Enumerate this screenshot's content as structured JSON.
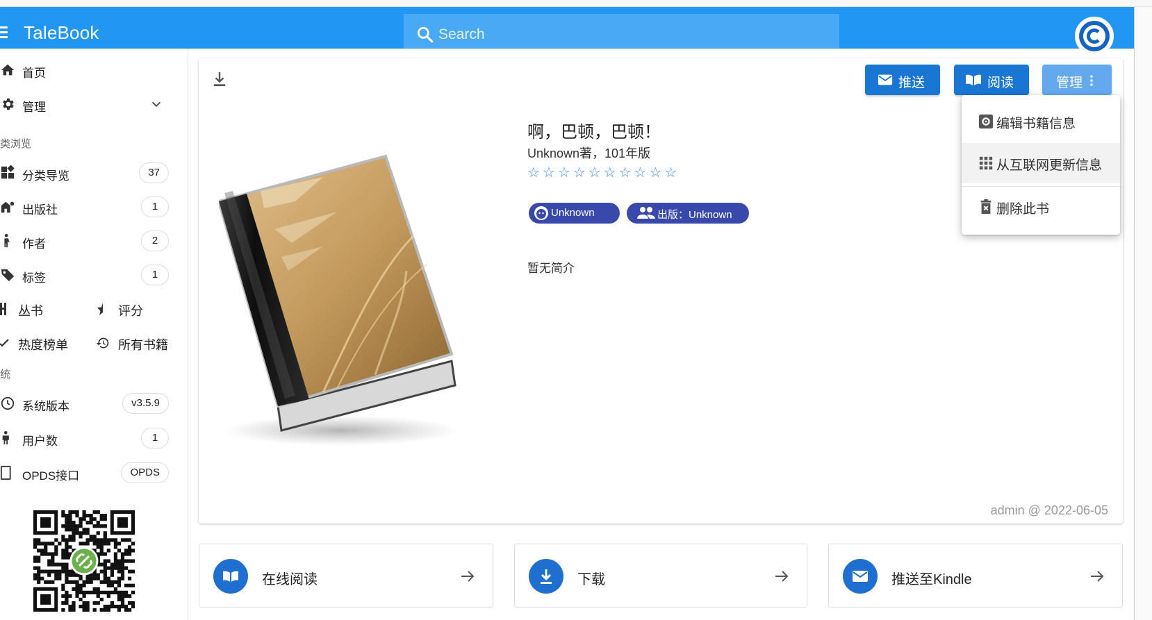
{
  "app": {
    "title": "TaleBook"
  },
  "search": {
    "placeholder": "Search"
  },
  "sidebar": {
    "home": "首页",
    "manage": "管理",
    "section_browse": "类浏览",
    "categories": [
      {
        "label": "分类导览",
        "count": "37"
      },
      {
        "label": "出版社",
        "count": "1"
      },
      {
        "label": "作者",
        "count": "2"
      },
      {
        "label": "标签",
        "count": "1"
      }
    ],
    "series": "丛书",
    "rating": "评分",
    "hot": "热度榜单",
    "all_books": "所有书籍",
    "section_system": "统",
    "system": [
      {
        "label": "系统版本",
        "count": "v3.5.9"
      },
      {
        "label": "用户数",
        "count": "1"
      },
      {
        "label": "OPDS接口",
        "count": "OPDS"
      }
    ]
  },
  "toolbar": {
    "push": "推送",
    "read": "阅读",
    "manage": "管理"
  },
  "menu": {
    "edit": "编辑书籍信息",
    "update": "从互联网更新信息",
    "delete": "删除此书"
  },
  "book": {
    "title": "啊，巴顿，巴顿！",
    "subtitle": "Unknown著，101年版",
    "stars": "☆☆☆☆☆☆☆☆☆☆",
    "author_chip": "Unknown",
    "publisher_chip": "出版：Unknown",
    "summary": "暂无简介",
    "meta": "admin @ 2022-06-05"
  },
  "actions": [
    {
      "label": "在线阅读"
    },
    {
      "label": "下载"
    },
    {
      "label": "推送至Kindle"
    }
  ],
  "colors": {
    "primary": "#2196f3",
    "button": "#1976d2",
    "chip": "#3949ab",
    "manage_button": "#64a8ee"
  }
}
